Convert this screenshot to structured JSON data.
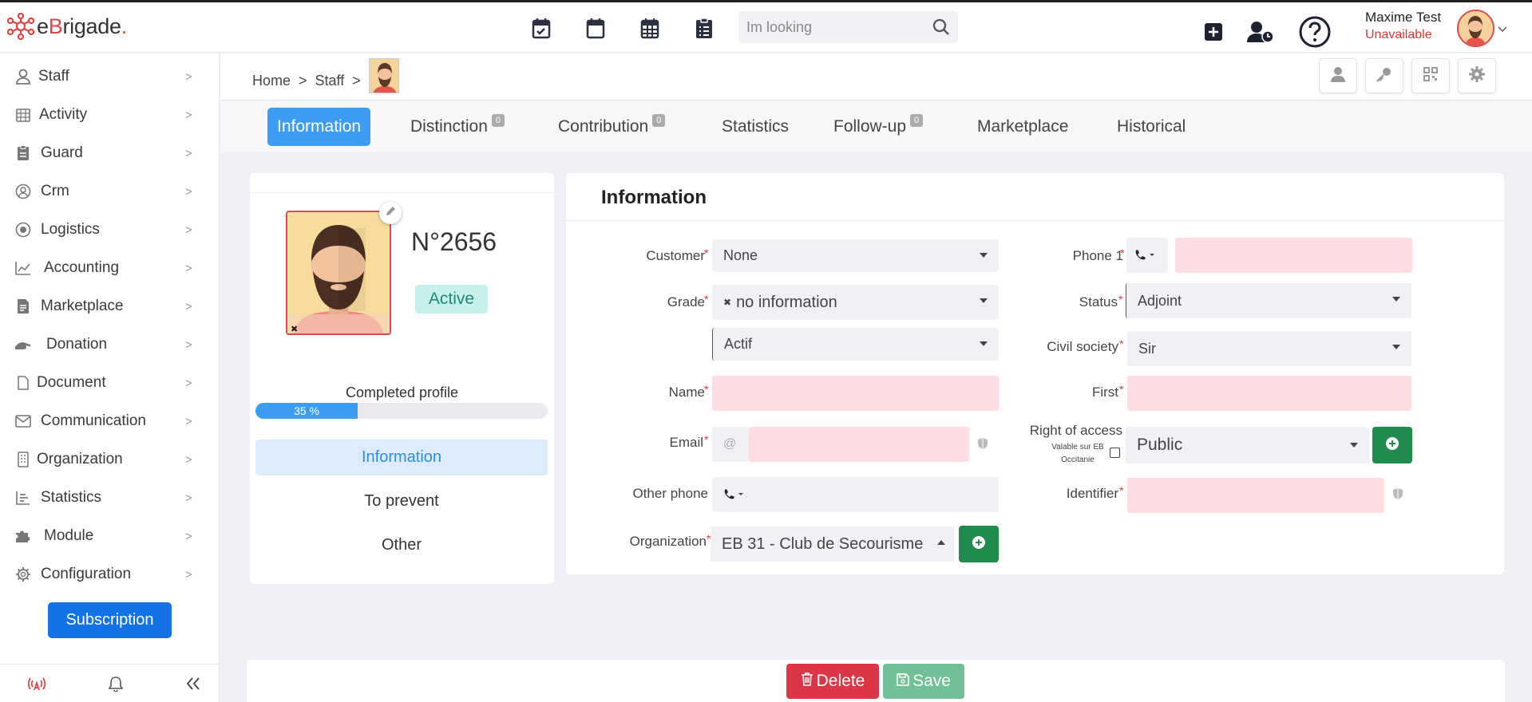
{
  "app": {
    "logo_prefix": "e",
    "logo_brand": "B",
    "logo_rest": "rigade",
    "logo_dot": "."
  },
  "search": {
    "placeholder": "Im looking"
  },
  "user": {
    "name": "Maxime Test",
    "status": "Unavailable"
  },
  "sidebar": {
    "items": [
      {
        "label": "Staff",
        "icon": "person-icon"
      },
      {
        "label": "Activity",
        "icon": "calendar-grid-icon"
      },
      {
        "label": "Guard",
        "icon": "clipboard-icon"
      },
      {
        "label": "Crm",
        "icon": "user-circle-icon"
      },
      {
        "label": "Logistics",
        "icon": "target-icon"
      },
      {
        "label": "Accounting",
        "icon": "line-chart-icon"
      },
      {
        "label": "Marketplace",
        "icon": "receipt-icon"
      },
      {
        "label": "Donation",
        "icon": "hand-icon"
      },
      {
        "label": "Document",
        "icon": "file-icon"
      },
      {
        "label": "Communication",
        "icon": "envelope-icon"
      },
      {
        "label": "Organization",
        "icon": "building-icon"
      },
      {
        "label": "Statistics",
        "icon": "bar-chart-icon"
      },
      {
        "label": "Module",
        "icon": "puzzle-icon"
      },
      {
        "label": "Configuration",
        "icon": "gear-icon"
      }
    ],
    "subscription_label": "Subscription"
  },
  "breadcrumb": {
    "home": "Home",
    "sep": ">",
    "staff": "Staff"
  },
  "tabs": [
    {
      "label": "Information",
      "badge": null
    },
    {
      "label": "Distinction",
      "badge": "0"
    },
    {
      "label": "Contribution",
      "badge": "0"
    },
    {
      "label": "Statistics",
      "badge": null
    },
    {
      "label": "Follow-up",
      "badge": "0"
    },
    {
      "label": "Marketplace",
      "badge": null
    },
    {
      "label": "Historical",
      "badge": null
    }
  ],
  "profile": {
    "number": "N°2656",
    "status_badge": "Active",
    "completed_label": "Completed profile",
    "progress_text": "35 %",
    "progress_fraction": 0.35,
    "nav": [
      "Information",
      "To prevent",
      "Other"
    ]
  },
  "form": {
    "title": "Information",
    "customer": {
      "label": "Customer",
      "value": "None"
    },
    "grade": {
      "label": "Grade",
      "value": "no information",
      "sub_value": "Actif"
    },
    "name": {
      "label": "Name",
      "value": ""
    },
    "email": {
      "label": "Email",
      "prefix": "@",
      "value": ""
    },
    "other_phone": {
      "label": "Other phone"
    },
    "organization": {
      "label": "Organization",
      "value": "EB 31 - Club de Secourisme"
    },
    "phone1": {
      "label": "Phone 1",
      "value": ""
    },
    "status": {
      "label": "Status",
      "value": "Adjoint"
    },
    "civil": {
      "label": "Civil society",
      "value": "Sir"
    },
    "first": {
      "label": "First",
      "value": ""
    },
    "access": {
      "label": "Right of access",
      "sub1": "Valable sur EB",
      "sub2": "Occitanie",
      "value": "Public"
    },
    "identifier": {
      "label": "Identifier",
      "value": ""
    }
  },
  "actions": {
    "delete": "Delete",
    "save": "Save"
  },
  "colors": {
    "accent": "#3d9df5",
    "danger": "#dc3545",
    "success": "#1f8b4c",
    "brand_red": "#e04545"
  }
}
